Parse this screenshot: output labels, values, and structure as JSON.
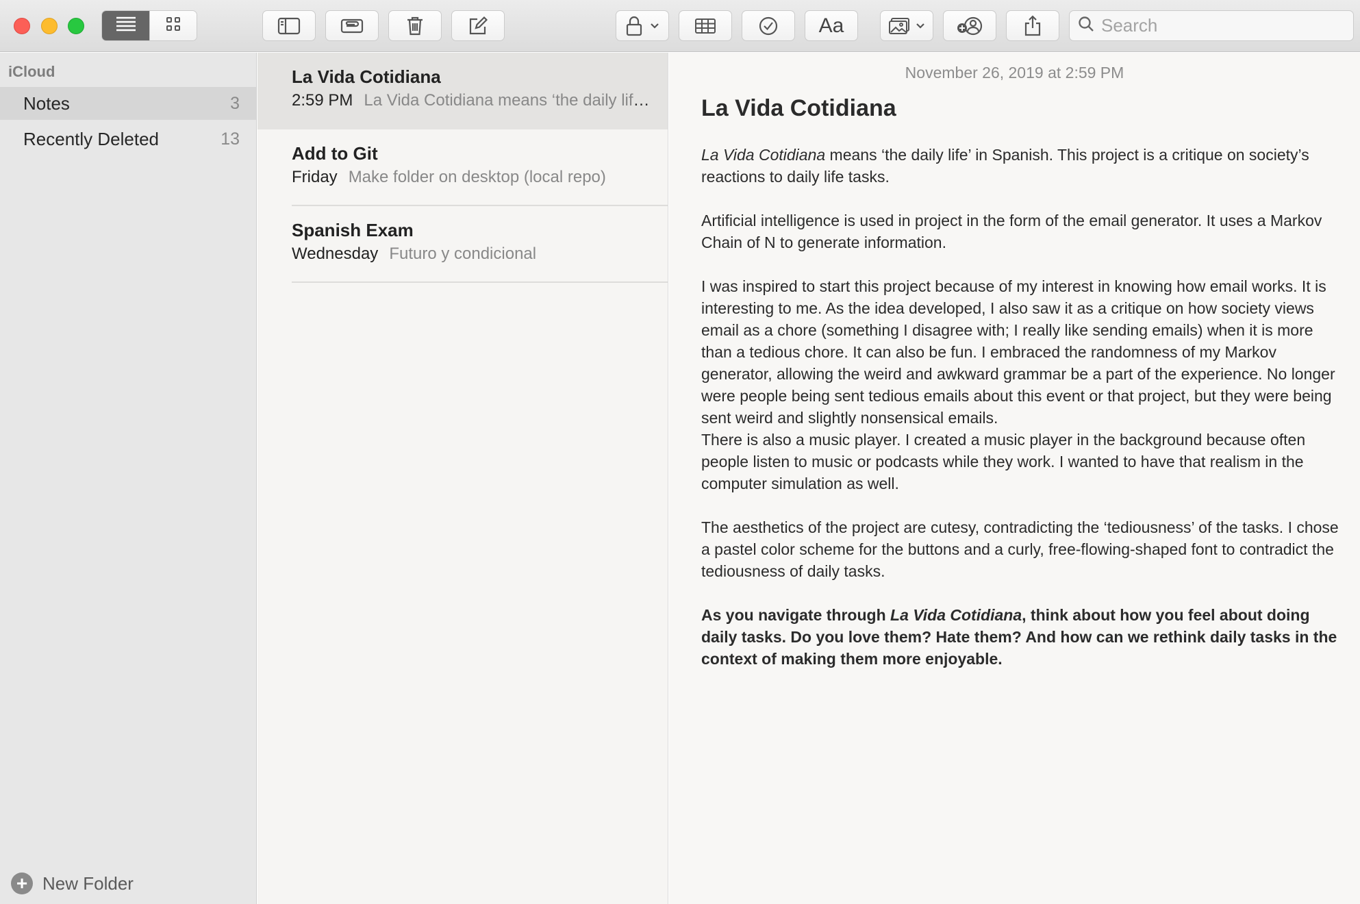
{
  "toolbar": {
    "search_placeholder": "Search",
    "format_label": "Aa",
    "icons": [
      "list-view-icon",
      "gallery-view-icon",
      "sidebar-toggle-icon",
      "attachments-icon",
      "trash-icon",
      "compose-icon",
      "lock-icon",
      "table-icon",
      "checklist-icon",
      "format-icon",
      "media-icon",
      "collaborate-icon",
      "share-icon",
      "search-icon"
    ]
  },
  "sidebar": {
    "section": "iCloud",
    "items": [
      {
        "label": "Notes",
        "count": "3"
      },
      {
        "label": "Recently Deleted",
        "count": "13"
      }
    ],
    "new_folder": "New Folder"
  },
  "notes": [
    {
      "title": "La Vida Cotidiana",
      "date": "2:59 PM",
      "preview": "La Vida Cotidiana means ‘the daily life’ in Spanish. This project is a critique on society’s reactions to daily life tasks."
    },
    {
      "title": "Add to Git",
      "date": "Friday",
      "preview": "Make folder on desktop (local repo)"
    },
    {
      "title": "Spanish Exam",
      "date": "Wednesday",
      "preview": "Futuro y condicional"
    }
  ],
  "editor": {
    "date": "November 26, 2019 at 2:59 PM",
    "title": "La Vida Cotidiana",
    "p1_em": "La Vida Cotidiana",
    "p1_rest": " means ‘the daily life’ in Spanish. This project is a critique on society’s reactions to daily life tasks.",
    "p2": "Artificial intelligence is used in project in the form of the email generator. It uses a Markov Chain of N to generate information.",
    "p3": "I was inspired to start this project because of my interest in knowing how email works. It is interesting to me. As the idea developed, I also saw it as a critique on how society views email as a chore (something I disagree with; I really like sending emails) when it is more than a tedious chore. It can also be fun. I embraced the randomness of my Markov generator, allowing the weird and awkward grammar be a part of the experience. No longer were people being sent tedious emails about this event or that project, but they were being sent weird and slightly nonsensical emails.",
    "p4": "There is also a music player. I created a music player in the background because often people listen to music or podcasts while they work. I wanted to have that realism in the computer simulation as well.",
    "p5": "The aesthetics of the project are cutesy, contradicting the ‘tediousness’ of the tasks. I chose a pastel color scheme for the buttons and a curly, free-flowing-shaped font to contradict the tediousness of daily tasks.",
    "p6_a": "As you navigate through ",
    "p6_em": "La Vida Cotidiana",
    "p6_b": ", think about how you feel about doing daily tasks. Do you love them? Hate them? And how can we rethink daily tasks in the context of making them more enjoyable."
  }
}
